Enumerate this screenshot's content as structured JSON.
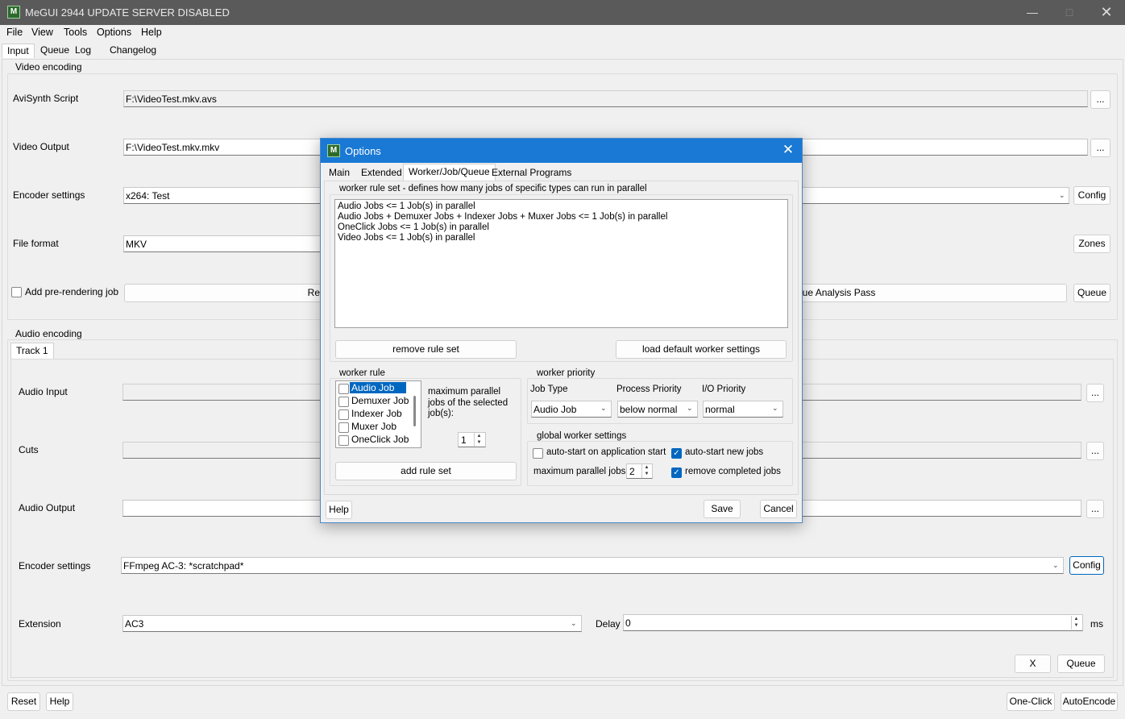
{
  "window": {
    "title": "MeGUI 2944 UPDATE SERVER DISABLED",
    "icon": "megui-app-icon"
  },
  "menu": [
    "File",
    "View",
    "Tools",
    "Options",
    "Help"
  ],
  "main_tabs": [
    "Input",
    "Queue",
    "Log",
    "Changelog"
  ],
  "video": {
    "group_label": "Video encoding",
    "avisynth_label": "AviSynth Script",
    "avisynth_value": "F:\\VideoTest.mkv.avs",
    "output_label": "Video Output",
    "output_value": "F:\\VideoTest.mkv.mkv",
    "encoder_label": "Encoder settings",
    "encoder_value": "x264: Test",
    "format_label": "File format",
    "format_value": "MKV",
    "prerender_label": "Add pre-rendering job",
    "prerender_btn_text": "Re",
    "analysis_text": "eue Analysis Pass",
    "browse": "...",
    "config": "Config",
    "zones": "Zones",
    "queue": "Queue"
  },
  "audio": {
    "group_label": "Audio encoding",
    "track_tab": "Track 1",
    "input_label": "Audio Input",
    "cuts_label": "Cuts",
    "output_label": "Audio Output",
    "encoder_label": "Encoder settings",
    "encoder_value": "FFmpeg AC-3: *scratchpad*",
    "extension_label": "Extension",
    "extension_value": "AC3",
    "delay_label": "Delay",
    "delay_value": "0",
    "delay_unit": "ms",
    "browse": "...",
    "config": "Config",
    "x_btn": "X",
    "queue": "Queue"
  },
  "bottom": {
    "reset": "Reset",
    "help": "Help",
    "oneclick": "One-Click",
    "autoencode": "AutoEncode"
  },
  "dialog": {
    "title": "Options",
    "tabs": [
      "Main",
      "Extended",
      "Worker/Job/Queue",
      "External Programs"
    ],
    "ruleset_group": "worker rule set - defines how many jobs of specific types can run in parallel",
    "rules": [
      "Audio Jobs  <= 1 Job(s) in parallel",
      "Audio Jobs + Demuxer Jobs + Indexer Jobs + Muxer Jobs  <= 1 Job(s) in parallel",
      "OneClick Jobs  <= 1 Job(s) in parallel",
      "Video Jobs  <= 1 Job(s) in parallel"
    ],
    "remove_rule_set": "remove rule set",
    "load_default": "load default worker settings",
    "worker_rule_group": "worker rule",
    "job_types": [
      "Audio Job",
      "Demuxer Job",
      "Indexer Job",
      "Muxer Job",
      "OneClick Job"
    ],
    "max_parallel_label": "maximum parallel jobs of the selected job(s):",
    "max_parallel_value": "1",
    "add_rule_set": "add rule set",
    "priority_group": "worker priority",
    "job_type_label": "Job Type",
    "job_type_value": "Audio Job",
    "process_priority_label": "Process Priority",
    "process_priority_value": "below normal",
    "io_priority_label": "I/O Priority",
    "io_priority_value": "normal",
    "global_group": "global worker settings",
    "autostart_app": "auto-start on application start",
    "autostart_new": "auto-start new jobs",
    "max_parallel_jobs_label": "maximum parallel jobs",
    "max_parallel_jobs_value": "2",
    "remove_completed": "remove completed jobs",
    "help": "Help",
    "save": "Save",
    "cancel": "Cancel"
  },
  "colors": {
    "accent": "#0067c0",
    "dialog_title": "#1a79d4",
    "main_title": "#5a5a5a"
  }
}
